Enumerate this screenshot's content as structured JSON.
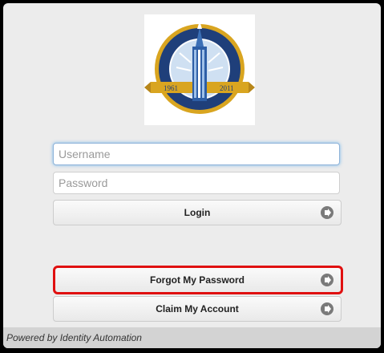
{
  "login_form": {
    "username_placeholder": "Username",
    "password_placeholder": "Password",
    "login_label": "Login"
  },
  "links": {
    "forgot_password_label": "Forgot My Password",
    "claim_account_label": "Claim My Account"
  },
  "logo": {
    "year_left": "1961",
    "year_right": "2011"
  },
  "footer": {
    "powered_by": "Powered by Identity Automation"
  },
  "icons": {
    "button_arrow": "arrow-right-circle-icon"
  },
  "colors": {
    "highlight": "#e01010",
    "logo_gold": "#d9a520",
    "logo_blue": "#1f3f7a"
  }
}
